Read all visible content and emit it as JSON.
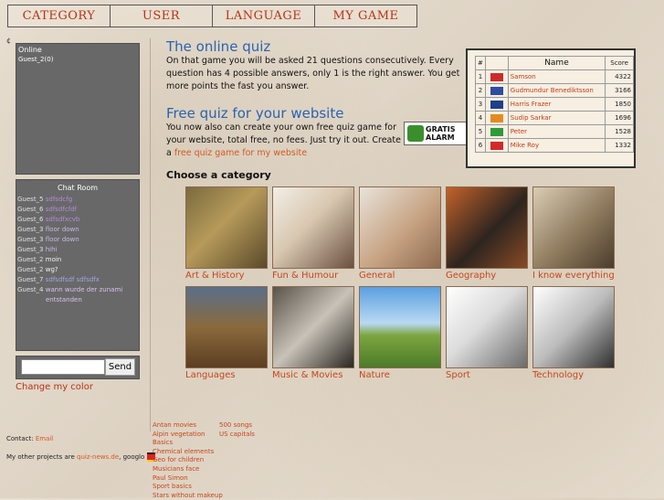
{
  "nav": [
    "CATEGORY",
    "USER",
    "LANGUAGE",
    "MY GAME"
  ],
  "tiny_mark": "¢",
  "online": {
    "title": "Online",
    "users": [
      "Guest_2(0)"
    ]
  },
  "chat": {
    "title": "Chat Room",
    "lines": [
      {
        "name": "Guest_5",
        "msg": "sdfsdcfg",
        "color": "#b38bd9"
      },
      {
        "name": "Guest_6",
        "msg": "sdfsdfcfdf",
        "color": "#b38bd9"
      },
      {
        "name": "Guest_6",
        "msg": "sdfsdfxcvb",
        "color": "#b38bd9"
      },
      {
        "name": "Guest_3",
        "msg": "floor down",
        "color": "#c9b8e8"
      },
      {
        "name": "Guest_3",
        "msg": "floor down",
        "color": "#c9b8e8"
      },
      {
        "name": "Guest_3",
        "msg": "hihi",
        "color": "#c9b8e8"
      },
      {
        "name": "Guest_2",
        "msg": "moin",
        "color": "#f2f2f2"
      },
      {
        "name": "Guest_2",
        "msg": "wg?",
        "color": "#f2f2f2"
      },
      {
        "name": "Guest_7",
        "msg": "sdfsdfsdf sdfsdfx",
        "color": "#9fa7e6"
      },
      {
        "name": "Guest_4",
        "msg": "wann wurde der zunami",
        "color": "#d8c2ee"
      }
    ],
    "continuation": "entstanden",
    "input_placeholder": "",
    "send_label": "Send",
    "change_color": "Change my color"
  },
  "intro": {
    "title": "The online quiz",
    "text": "On that game you will be asked 21 questions consecutively. Every question has 4 possible answers, only 1 is the right answer. You get more points the fast you answer."
  },
  "free": {
    "title": "Free quiz for your website",
    "text_before": "You now also can create your own free quiz game for your website, total free, no fees. Just try it out. Create a ",
    "link": "free quiz game for my website",
    "badge_line1": "GRATIS",
    "badge_line2": "ALARM"
  },
  "score": {
    "headers": [
      "#",
      "Name",
      "Score"
    ],
    "rows": [
      {
        "rank": "1",
        "name": "Samson",
        "score": "4322",
        "flag": "#cc2b2b"
      },
      {
        "rank": "2",
        "name": "Gudmundur Benediktsson",
        "score": "3166",
        "flag": "#2e4da0"
      },
      {
        "rank": "3",
        "name": "Harris Frazer",
        "score": "1850",
        "flag": "#1e3f8a"
      },
      {
        "rank": "4",
        "name": "Sudip Sarkar",
        "score": "1696",
        "flag": "#e68a1e"
      },
      {
        "rank": "5",
        "name": "Peter",
        "score": "1528",
        "flag": "#2f9a3a"
      },
      {
        "rank": "6",
        "name": "Mike Roy",
        "score": "1332",
        "flag": "#d22a2a"
      }
    ]
  },
  "choose": "Choose a category",
  "categories": [
    {
      "label": "Art & History",
      "bg": "linear-gradient(135deg,#7a6b3e,#b69a5a 45%,#5a4a2a)"
    },
    {
      "label": "Fun & Humour",
      "bg": "linear-gradient(135deg,#f3eee6,#d8c7b0 45%,#6a5040)"
    },
    {
      "label": "General",
      "bg": "linear-gradient(135deg,#e8e3da,#c7a383 55%,#8f6a50)"
    },
    {
      "label": "Geography",
      "bg": "linear-gradient(135deg,#c4622a,#2d2520 55%,#8a4a25)"
    },
    {
      "label": "I know everything",
      "bg": "linear-gradient(135deg,#d9cdb4,#8e7a5d 55%,#4a3d2c)"
    },
    {
      "label": "Languages",
      "bg": "linear-gradient(180deg,#5a6f8a,#8a6a3c 50%,#5c3e22)"
    },
    {
      "label": "Music & Movies",
      "bg": "linear-gradient(135deg,#5a534a,#c8c2b8 50%,#2a2620)"
    },
    {
      "label": "Nature",
      "bg": "linear-gradient(180deg,#5aa0e0,#b9d9f2 45%,#7da640 60%,#4c7a28)"
    },
    {
      "label": "Sport",
      "bg": "linear-gradient(135deg,#ffffff,#dcdcdc 45%,#6b6b6b)"
    },
    {
      "label": "Technology",
      "bg": "linear-gradient(135deg,#ffffff,#bcbcbc 50%,#2f2f2f)"
    }
  ],
  "footer": {
    "contact_label": "Contact:",
    "contact_link": "Email",
    "projects_label": "My other projects are",
    "projects_link": "quiz-news.de",
    "projects_tail": ", googlo",
    "links_col1": [
      "Antan movies",
      "Alpin vegetation",
      "Basics",
      "Chemical elements",
      "Geo for children",
      "Musicians face",
      "Paul Simon",
      "Sport basics",
      "Stars without makeup"
    ],
    "links_col2": [
      "500 songs",
      "US capitals"
    ]
  }
}
